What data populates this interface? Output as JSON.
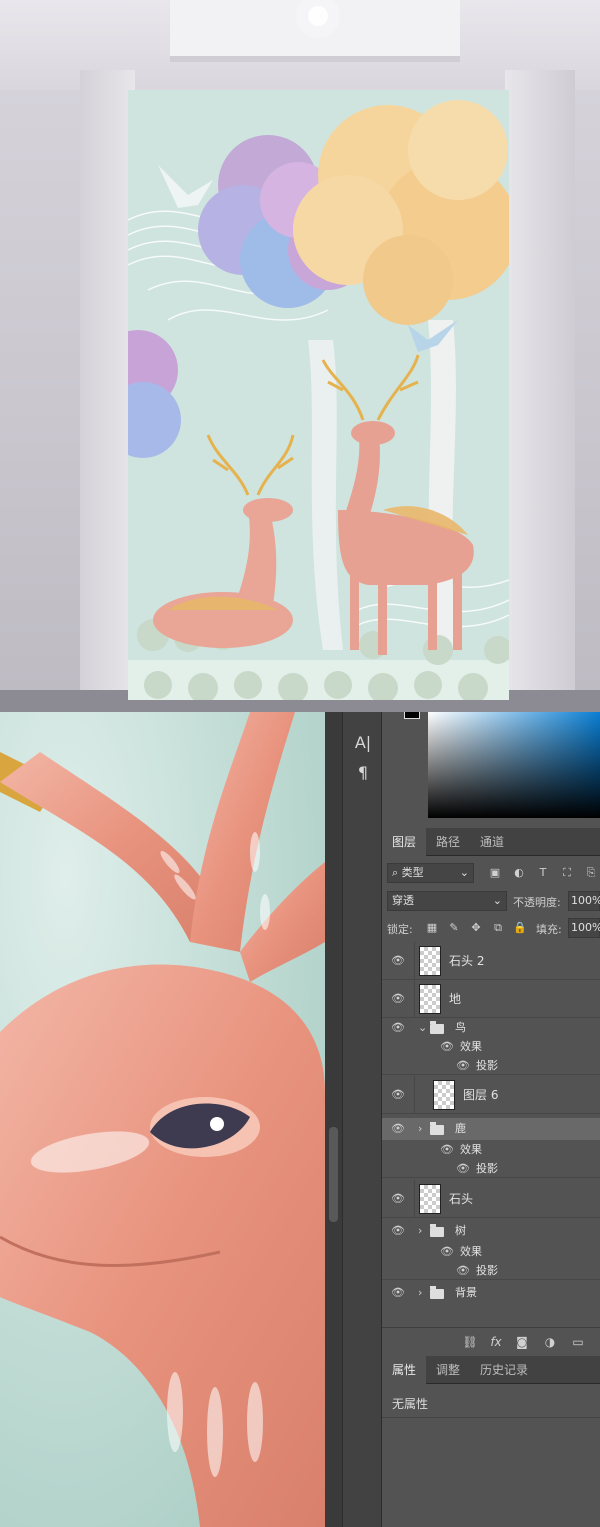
{
  "tools": [
    {
      "name": "text-tool",
      "glyph": "A|"
    },
    {
      "name": "paragraph-tool",
      "glyph": "¶"
    }
  ],
  "layers_panel": {
    "tabs": [
      "图层",
      "路径",
      "通道"
    ],
    "filter_label": "⌕ 类型",
    "blend_mode": "穿透",
    "opacity_label": "不透明度:",
    "opacity_value": "100%",
    "lock_label": "锁定:",
    "fill_label": "填充:",
    "fill_value": "100%",
    "layers": [
      {
        "name": "石头 2",
        "kind": "layer"
      },
      {
        "name": "地",
        "kind": "layer"
      },
      {
        "name": "鸟",
        "kind": "group",
        "expanded": true
      },
      {
        "name": "效果",
        "kind": "effect"
      },
      {
        "name": "投影",
        "kind": "effect-item"
      },
      {
        "name": "图层 6",
        "kind": "layer"
      },
      {
        "name": "鹿",
        "kind": "group",
        "expanded": false,
        "selected": true
      },
      {
        "name": "效果",
        "kind": "effect"
      },
      {
        "name": "投影",
        "kind": "effect-item"
      },
      {
        "name": "石头",
        "kind": "layer"
      },
      {
        "name": "树",
        "kind": "group",
        "expanded": false
      },
      {
        "name": "效果",
        "kind": "effect"
      },
      {
        "name": "投影",
        "kind": "effect-item"
      },
      {
        "name": "背景",
        "kind": "group",
        "expanded": false
      }
    ]
  },
  "properties_panel": {
    "tabs": [
      "属性",
      "调整",
      "历史记录"
    ],
    "content": "无属性"
  },
  "colors": {
    "panel_bg": "#535353",
    "selected_row": "#696969",
    "mural_bg": "#cfe4df",
    "deer": "#e9a596"
  }
}
